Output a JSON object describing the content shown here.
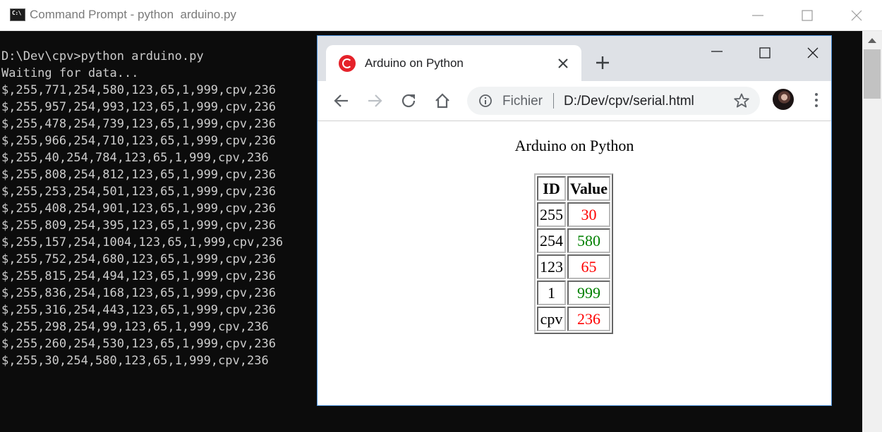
{
  "console_window": {
    "title": "Command Prompt - python  arduino.py",
    "icon_label": "C:\\",
    "lines": [
      "D:\\Dev\\cpv>python arduino.py",
      "Waiting for data...",
      "$,255,771,254,580,123,65,1,999,cpv,236",
      "$,255,957,254,993,123,65,1,999,cpv,236",
      "$,255,478,254,739,123,65,1,999,cpv,236",
      "$,255,966,254,710,123,65,1,999,cpv,236",
      "$,255,40,254,784,123,65,1,999,cpv,236",
      "$,255,808,254,812,123,65,1,999,cpv,236",
      "$,255,253,254,501,123,65,1,999,cpv,236",
      "$,255,408,254,901,123,65,1,999,cpv,236",
      "$,255,809,254,395,123,65,1,999,cpv,236",
      "$,255,157,254,1004,123,65,1,999,cpv,236",
      "$,255,752,254,680,123,65,1,999,cpv,236",
      "$,255,815,254,494,123,65,1,999,cpv,236",
      "$,255,836,254,168,123,65,1,999,cpv,236",
      "$,255,316,254,443,123,65,1,999,cpv,236",
      "$,255,298,254,99,123,65,1,999,cpv,236",
      "$,255,260,254,530,123,65,1,999,cpv,236",
      "$,255,30,254,580,123,65,1,999,cpv,236"
    ]
  },
  "browser": {
    "tab_title": "Arduino on Python",
    "address_scheme": "Fichier",
    "address_url": "D:/Dev/cpv/serial.html",
    "page": {
      "heading": "Arduino on Python",
      "table": {
        "headers": [
          "ID",
          "Value"
        ],
        "rows": [
          {
            "id": "255",
            "value": "30",
            "color": "#ff0000"
          },
          {
            "id": "254",
            "value": "580",
            "color": "#008000"
          },
          {
            "id": "123",
            "value": "65",
            "color": "#ff0000"
          },
          {
            "id": "1",
            "value": "999",
            "color": "#008000"
          },
          {
            "id": "cpv",
            "value": "236",
            "color": "#ff0000"
          }
        ]
      }
    }
  }
}
